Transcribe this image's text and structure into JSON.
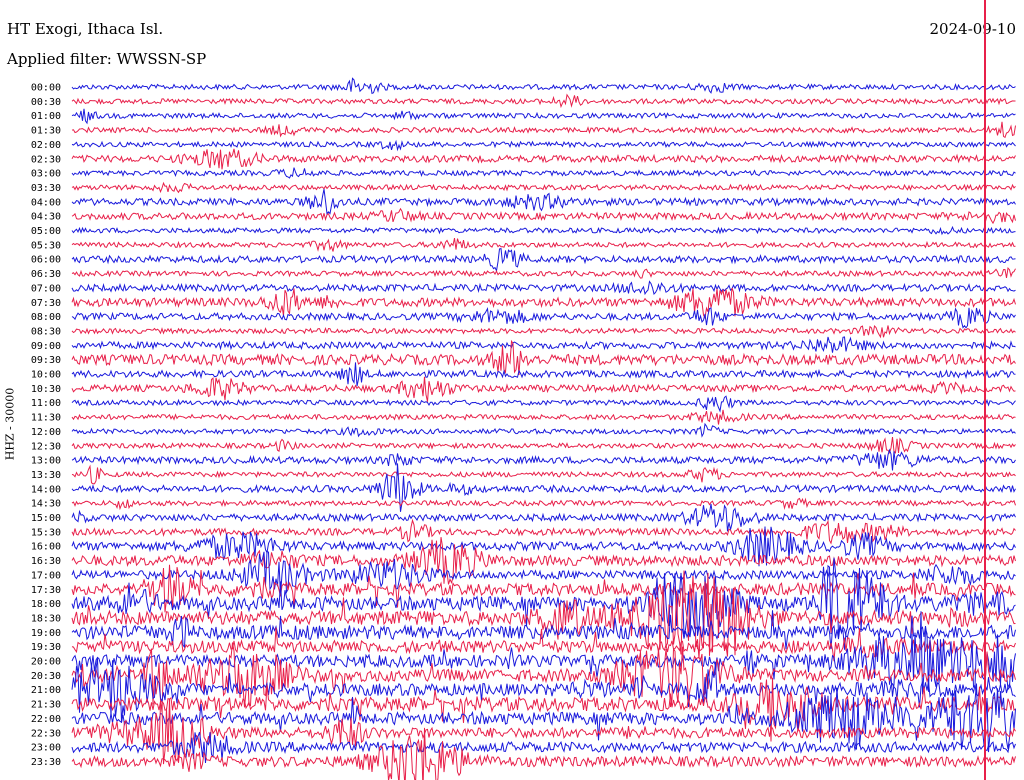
{
  "header": {
    "station": "HT Exogi, Ithaca Isl.",
    "date": "2024-09-10",
    "filter": "Applied filter: WWSSN-SP"
  },
  "axis": {
    "channel_label": "HHZ - 30000"
  },
  "colors": {
    "trace_a": "#1a1adc",
    "trace_b": "#e8204a",
    "marker": "#e8204a"
  },
  "chart_data": {
    "type": "line",
    "title": "HT Exogi, Ithaca Isl.",
    "subtitle": "Applied filter: WWSSN-SP",
    "ylabel": "HHZ - 30000",
    "y_ticks": [
      "00:00",
      "00:30",
      "01:00",
      "01:30",
      "02:00",
      "02:30",
      "03:00",
      "03:30",
      "04:00",
      "04:30",
      "05:00",
      "05:30",
      "06:00",
      "06:30",
      "07:00",
      "07:30",
      "08:00",
      "08:30",
      "09:00",
      "09:30",
      "10:00",
      "10:30",
      "11:00",
      "11:30",
      "12:00",
      "12:30",
      "13:00",
      "13:30",
      "14:00",
      "14:30",
      "15:00",
      "15:30",
      "16:00",
      "16:30",
      "17:00",
      "17:30",
      "18:00",
      "18:30",
      "19:00",
      "19:30",
      "20:00",
      "20:30",
      "21:00",
      "21:30",
      "22:00",
      "22:30",
      "23:00",
      "23:30"
    ],
    "row_colors": [
      "blue",
      "red"
    ],
    "activity": [
      1,
      1,
      1,
      1,
      1,
      2,
      1,
      1,
      2,
      2,
      1,
      1,
      2,
      1,
      2,
      3,
      2,
      1,
      2,
      4,
      2,
      2,
      1,
      1,
      1,
      1,
      2,
      1,
      2,
      1,
      2,
      2,
      3,
      4,
      3,
      5,
      6,
      6,
      6,
      5,
      5,
      5,
      5,
      6,
      5,
      4,
      4,
      4
    ],
    "current_time_marker": "23:45",
    "grid": false,
    "legend": "none"
  }
}
